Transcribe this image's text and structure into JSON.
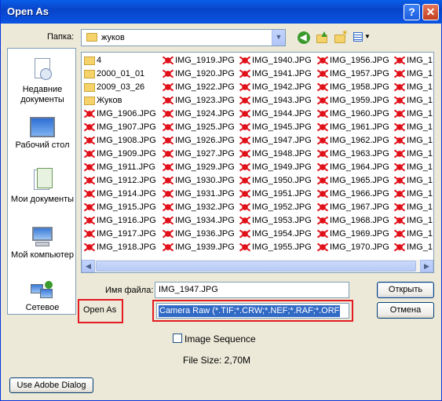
{
  "window": {
    "title": "Open As"
  },
  "toolbar": {
    "lookin_label": "Папка:",
    "lookin_value": "жуков"
  },
  "places": [
    {
      "label": "Недавние документы",
      "icon": "recent-docs-icon"
    },
    {
      "label": "Рабочий стол",
      "icon": "desktop-icon"
    },
    {
      "label": "Мои документы",
      "icon": "my-documents-icon"
    },
    {
      "label": "Мой компьютер",
      "icon": "my-computer-icon"
    },
    {
      "label": "Сетевое",
      "icon": "network-icon"
    }
  ],
  "files": {
    "col1": [
      "4",
      "2000_01_01",
      "2009_03_26",
      "Жуков",
      "IMG_1906.JPG",
      "IMG_1907.JPG",
      "IMG_1908.JPG",
      "IMG_1909.JPG",
      "IMG_1911.JPG",
      "IMG_1912.JPG",
      "IMG_1914.JPG",
      "IMG_1915.JPG",
      "IMG_1916.JPG",
      "IMG_1917.JPG",
      "IMG_1918.JPG"
    ],
    "col2": [
      "IMG_1919.JPG",
      "IMG_1920.JPG",
      "IMG_1922.JPG",
      "IMG_1923.JPG",
      "IMG_1924.JPG",
      "IMG_1925.JPG",
      "IMG_1926.JPG",
      "IMG_1927.JPG",
      "IMG_1929.JPG",
      "IMG_1930.JPG",
      "IMG_1931.JPG",
      "IMG_1932.JPG",
      "IMG_1934.JPG",
      "IMG_1936.JPG",
      "IMG_1939.JPG"
    ],
    "col3": [
      "IMG_1940.JPG",
      "IMG_1941.JPG",
      "IMG_1942.JPG",
      "IMG_1943.JPG",
      "IMG_1944.JPG",
      "IMG_1945.JPG",
      "IMG_1947.JPG",
      "IMG_1948.JPG",
      "IMG_1949.JPG",
      "IMG_1950.JPG",
      "IMG_1951.JPG",
      "IMG_1952.JPG",
      "IMG_1953.JPG",
      "IMG_1954.JPG",
      "IMG_1955.JPG"
    ],
    "col4": [
      "IMG_1956.JPG",
      "IMG_1957.JPG",
      "IMG_1958.JPG",
      "IMG_1959.JPG",
      "IMG_1960.JPG",
      "IMG_1961.JPG",
      "IMG_1962.JPG",
      "IMG_1963.JPG",
      "IMG_1964.JPG",
      "IMG_1965.JPG",
      "IMG_1966.JPG",
      "IMG_1967.JPG",
      "IMG_1968.JPG",
      "IMG_1969.JPG",
      "IMG_1970.JPG"
    ],
    "col5": [
      "IMG_1",
      "IMG_1",
      "IMG_1",
      "IMG_1",
      "IMG_1",
      "IMG_1",
      "IMG_1",
      "IMG_1",
      "IMG_1",
      "IMG_1",
      "IMG_1",
      "IMG_1",
      "IMG_1",
      "IMG_1",
      "IMG_1"
    ],
    "folder_count": 4
  },
  "form": {
    "filename_label": "Имя файла:",
    "filename_value": "IMG_1947.JPG",
    "openas_label": "Open As",
    "openas_value": "Camera Raw (*.TIF;*.CRW;*.NEF;*.RAF;*.ORF",
    "open_button": "Открыть",
    "cancel_button": "Отмена",
    "image_sequence_label": "Image Sequence",
    "image_sequence_checked": false,
    "filesize_text": "File Size: 2,70M",
    "adobe_dialog_button": "Use Adobe Dialog"
  },
  "colors": {
    "highlight": "#e31c23",
    "selection": "#316ac5",
    "titlebar": "#0a54e2"
  }
}
